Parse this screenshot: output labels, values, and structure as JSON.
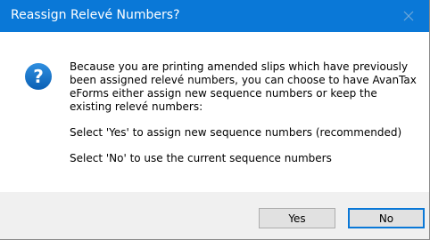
{
  "window": {
    "title": "Reassign Relevé Numbers?",
    "titlebar_color": "#0a78d7",
    "close_icon": "close-icon"
  },
  "message": {
    "icon": "question-icon",
    "paragraph_1": "Because you are printing amended slips which have previously been assigned relevé numbers, you can choose to have AvanTax eForms either assign new sequence numbers or keep the existing relevé numbers:",
    "paragraph_2": "Select 'Yes' to assign new sequence numbers (recommended)",
    "paragraph_3": "Select 'No' to use the current sequence numbers"
  },
  "buttons": {
    "yes_label": "Yes",
    "no_label": "No",
    "default_button_color": "#0a78d7"
  }
}
